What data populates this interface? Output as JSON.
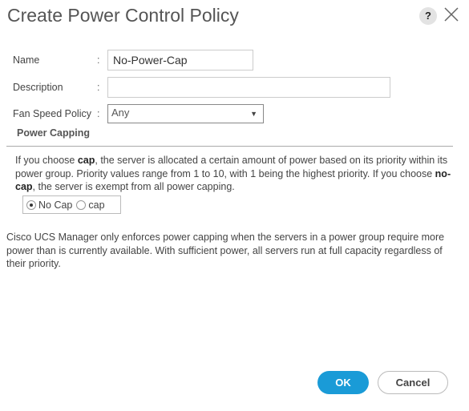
{
  "dialog": {
    "title": "Create Power Control Policy",
    "help_icon": "?",
    "close_icon": "close-icon"
  },
  "form": {
    "name_label": "Name",
    "name_value": "No-Power-Cap",
    "description_label": "Description",
    "description_value": "",
    "fan_label": "Fan Speed Policy",
    "fan_value": "Any",
    "colon": ":"
  },
  "power_capping": {
    "heading": "Power Capping",
    "para1_a": "If you choose ",
    "para1_b": "cap",
    "para1_c": ", the server is allocated a certain amount of power based on its priority within its power group. Priority values range from 1 to 10, with 1 being the highest priority. If you choose ",
    "para1_d": "no-cap",
    "para1_e": ", the server is exempt from all power capping.",
    "options": [
      {
        "label": "No Cap",
        "checked": true
      },
      {
        "label": "cap",
        "checked": false
      }
    ],
    "note": "Cisco UCS Manager only enforces power capping when the servers in a power group require more power than is currently available. With sufficient power, all servers run at full capacity regardless of their priority."
  },
  "buttons": {
    "ok": "OK",
    "cancel": "Cancel"
  },
  "colors": {
    "primary": "#1a9bd7"
  }
}
